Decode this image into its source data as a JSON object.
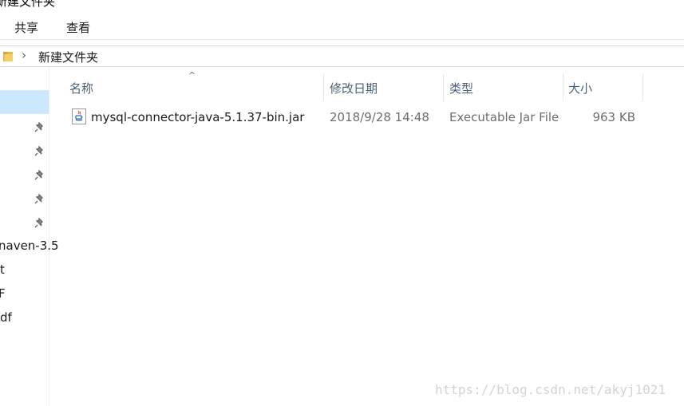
{
  "window": {
    "title": "新建文件夹"
  },
  "ribbon": {
    "tabs": [
      "共享",
      "查看"
    ]
  },
  "address": {
    "path": "新建文件夹"
  },
  "nav": {
    "visible_labels": [
      "naven-3.5",
      "t",
      "F",
      "df"
    ]
  },
  "columns": {
    "name": "名称",
    "modified": "修改日期",
    "type": "类型",
    "size": "大小"
  },
  "files": [
    {
      "name": "mysql-connector-java-5.1.37-bin.jar",
      "modified": "2018/9/28 14:48",
      "type": "Executable Jar File",
      "size": "963 KB",
      "icon": "java-jar-icon"
    }
  ],
  "watermark": "https://blog.csdn.net/akyj1021",
  "colors": {
    "selection": "#cce8ff",
    "header_text": "#4c607a",
    "folder": "#e8b84a"
  }
}
